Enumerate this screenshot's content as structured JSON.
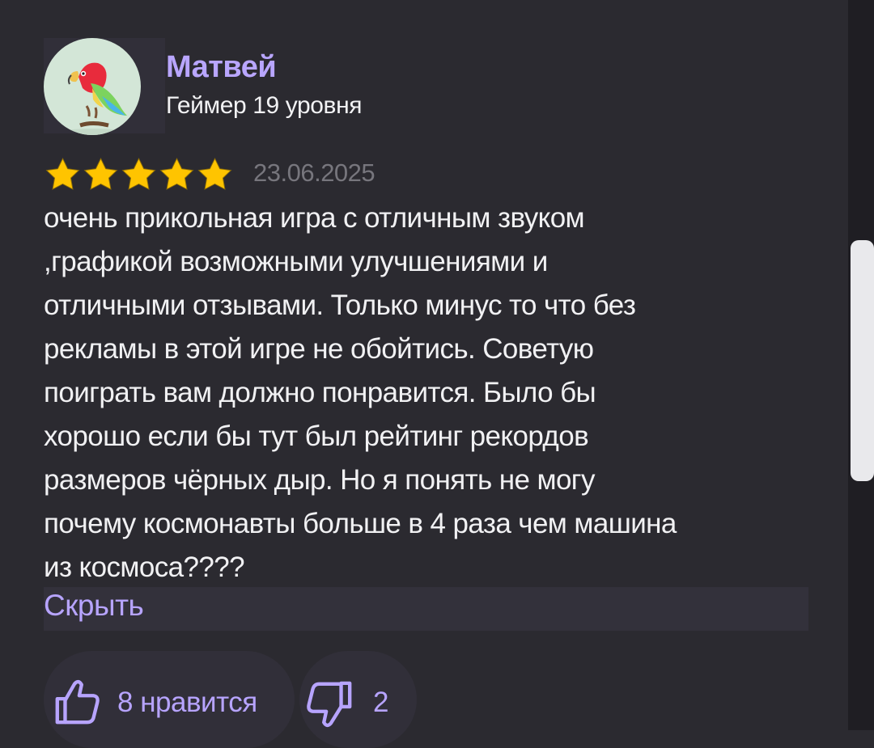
{
  "author": {
    "name": "Матвей",
    "level": "Геймер 19 уровня",
    "avatar_icon": "parrot-icon"
  },
  "rating": {
    "stars": 5,
    "max": 5,
    "date": "23.06.2025"
  },
  "review": {
    "lines": [
      "очень прикольная игра с отличным звуком",
      ",графикой возможными улучшениями и",
      "отличными отзывами. Только минус то что без",
      "рекламы в этой игре не обойтись. Советую",
      "поиграть вам должно понравится. Было бы",
      "хорошо если бы тут был рейтинг рекордов",
      "размеров чёрных дыр. Но я понять не могу",
      "почему космонавты больше в 4 раза чем машина",
      "из космоса????"
    ],
    "hide_label": "Скрыть"
  },
  "reactions": {
    "like_label": "8 нравится",
    "dislike_count": "2",
    "like_icon": "thumbs-up-icon",
    "dislike_icon": "thumbs-down-icon"
  },
  "colors": {
    "background": "#2b2a30",
    "accent": "#b7a4ff",
    "star": "#ffc400",
    "text": "#f1f1f3",
    "muted": "#77767d"
  }
}
